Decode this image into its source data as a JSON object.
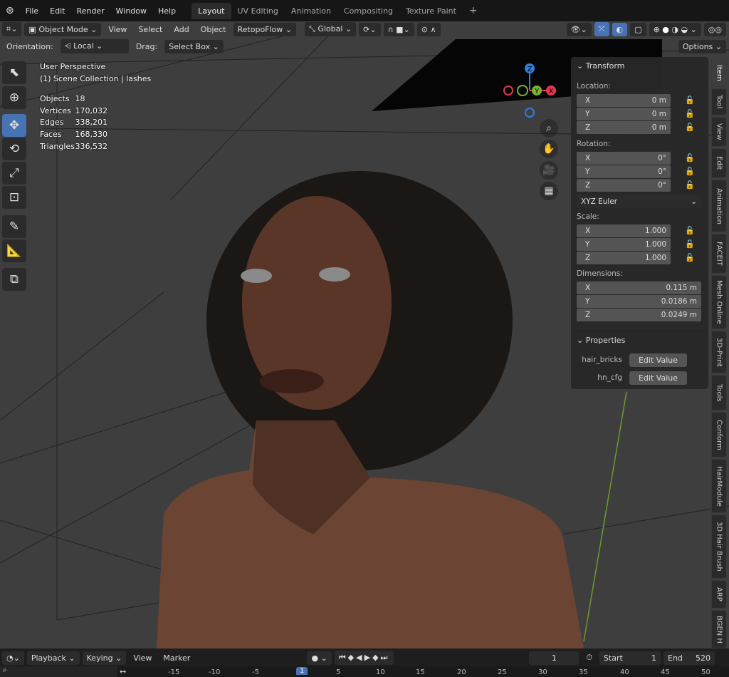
{
  "menubar": {
    "menus": [
      "File",
      "Edit",
      "Render",
      "Window",
      "Help"
    ],
    "workspaces": [
      "Layout",
      "UV Editing",
      "Animation",
      "Compositing",
      "Texture Paint"
    ],
    "active_workspace": "Layout",
    "add_label": "+"
  },
  "header": {
    "mode": "Object Mode",
    "menus": [
      "View",
      "Select",
      "Add",
      "Object"
    ],
    "addon_menu": "RetopoFlow",
    "transform_orientation": "Global"
  },
  "tool_settings": {
    "orientation_label": "Orientation:",
    "orientation_value": "Local",
    "drag_label": "Drag:",
    "drag_value": "Select Box",
    "options": "Options"
  },
  "overlay": {
    "view_name": "User Perspective",
    "collection": "(1) Scene Collection | lashes",
    "stats": [
      {
        "label": "Objects",
        "value": "18"
      },
      {
        "label": "Vertices",
        "value": "170,032"
      },
      {
        "label": "Edges",
        "value": "338,201"
      },
      {
        "label": "Faces",
        "value": "168,330"
      },
      {
        "label": "Triangles",
        "value": "336,532"
      }
    ]
  },
  "gizmo": {
    "x": "X",
    "y": "Y",
    "z": "Z",
    "x_color": "#e0394f",
    "y_color": "#7ab32e",
    "z_color": "#2f7fdd"
  },
  "npanel": {
    "transform_title": "Transform",
    "location_label": "Location:",
    "location": [
      {
        "axis": "X",
        "value": "0 m"
      },
      {
        "axis": "Y",
        "value": "0 m"
      },
      {
        "axis": "Z",
        "value": "0 m"
      }
    ],
    "rotation_label": "Rotation:",
    "rotation": [
      {
        "axis": "X",
        "value": "0°"
      },
      {
        "axis": "Y",
        "value": "0°"
      },
      {
        "axis": "Z",
        "value": "0°"
      }
    ],
    "rotation_mode": "XYZ Euler",
    "scale_label": "Scale:",
    "scale": [
      {
        "axis": "X",
        "value": "1.000"
      },
      {
        "axis": "Y",
        "value": "1.000"
      },
      {
        "axis": "Z",
        "value": "1.000"
      }
    ],
    "dimensions_label": "Dimensions:",
    "dimensions": [
      {
        "axis": "X",
        "value": "0.115 m"
      },
      {
        "axis": "Y",
        "value": "0.0186 m"
      },
      {
        "axis": "Z",
        "value": "0.0249 m"
      }
    ],
    "properties_title": "Properties",
    "properties": [
      {
        "name": "hair_bricks",
        "button": "Edit Value"
      },
      {
        "name": "hn_cfg",
        "button": "Edit Value"
      }
    ]
  },
  "sidebar_tabs": [
    "Item",
    "Tool",
    "View",
    "Edit",
    "Animation",
    "FACEIT",
    "Mesh Online",
    "3D-Print",
    "Tools",
    "Conform",
    "HairModule",
    "3D Hair Brush",
    "ARP",
    "BGEN H"
  ],
  "active_tab": "Item",
  "timeline": {
    "menus": [
      "Playback",
      "Keying",
      "View",
      "Marker"
    ],
    "current_frame": "1",
    "start_label": "Start",
    "start": "1",
    "end_label": "End",
    "end": "520",
    "ruler": [
      "-15",
      "-10",
      "-5",
      "1",
      "5",
      "10",
      "15",
      "20",
      "25",
      "30",
      "35",
      "40",
      "45",
      "50"
    ]
  }
}
